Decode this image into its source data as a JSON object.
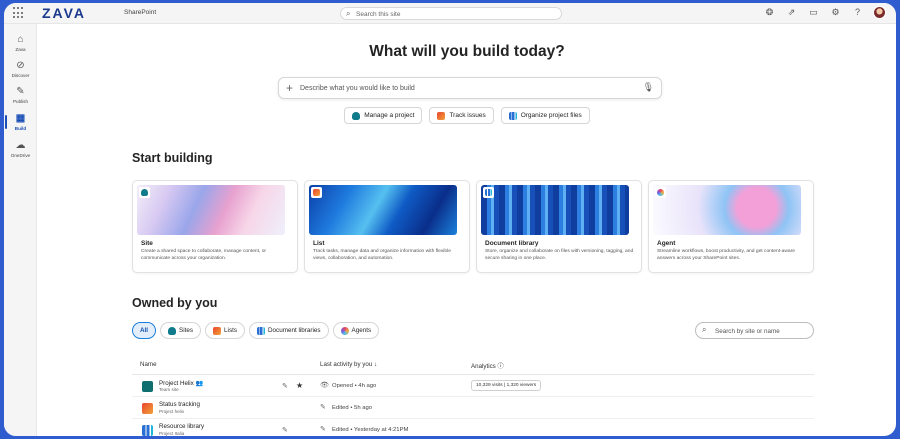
{
  "topbar": {
    "brand": "ZAVA",
    "app_name": "SharePoint",
    "search_placeholder": "Search this site",
    "icons": [
      "copilot-icon",
      "share-icon",
      "chat-icon",
      "settings-icon",
      "help-icon"
    ]
  },
  "rail": [
    {
      "label": "Zava",
      "icon": "home-icon"
    },
    {
      "label": "Discover",
      "icon": "compass-icon"
    },
    {
      "label": "Publish",
      "icon": "pencil-icon"
    },
    {
      "label": "Build",
      "icon": "layout-icon",
      "active": true
    },
    {
      "label": "OneDrive",
      "icon": "cloud-icon"
    }
  ],
  "hero": {
    "title": "What will you build today?",
    "prompt_placeholder": "Describe what you would like to build",
    "chips": [
      "Manage a project",
      "Track issues",
      "Organize project files"
    ]
  },
  "start_building": {
    "title": "Start building",
    "cards": [
      {
        "title": "Site",
        "desc": "Create a shared space to collaborate, manage content, or communicate across your organization."
      },
      {
        "title": "List",
        "desc": "Track tasks, manage data and organize information with flexible views, collaboration, and automation."
      },
      {
        "title": "Document library",
        "desc": "Store, organize and collaborate on files with versioning, tagging, and secure sharing in one place."
      },
      {
        "title": "Agent",
        "desc": "Streamline workflows, boost productivity, and get content-aware answers across your SharePoint sites."
      }
    ]
  },
  "owned": {
    "title": "Owned by you",
    "filters": [
      "All",
      "Sites",
      "Lists",
      "Document libraries",
      "Agents"
    ],
    "search_placeholder": "Search by site or name",
    "columns": {
      "name": "Name",
      "activity": "Last activity by you",
      "analytics": "Analytics"
    },
    "rows": [
      {
        "name": "Project Helix",
        "sub": "Team site",
        "activity": "Opened • 4h ago",
        "analytics": "10,329 visits | 1,320 viewers",
        "type": "site"
      },
      {
        "name": "Status tracking",
        "sub": "Project helix",
        "activity": "Edited • 5h ago",
        "analytics": "",
        "type": "list"
      },
      {
        "name": "Resource library",
        "sub": "Project Italia",
        "activity": "Edited • Yesterday at 4:21PM",
        "analytics": "",
        "type": "doc"
      }
    ]
  },
  "colors": {
    "accent": "#1a4fb5",
    "frame": "#2f5ccf"
  }
}
